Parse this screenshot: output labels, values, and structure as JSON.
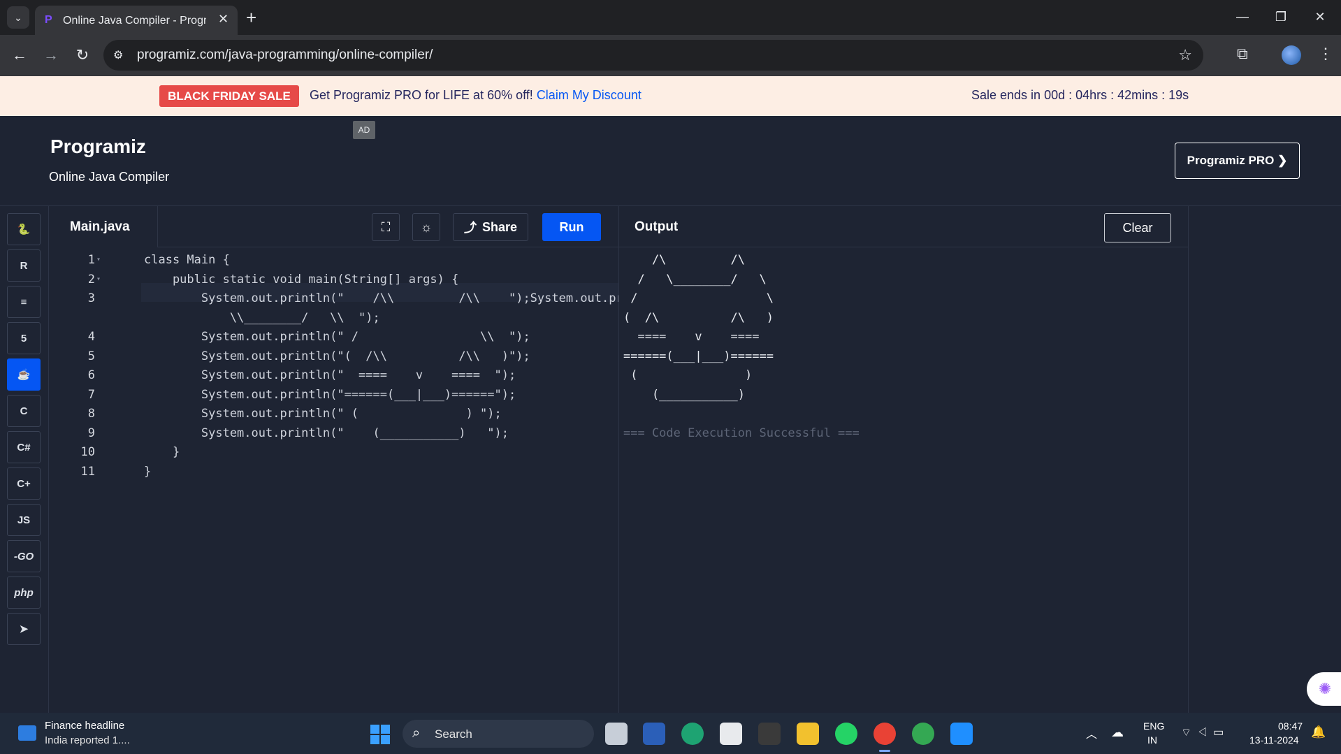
{
  "browser": {
    "tab_title": "Online Java Compiler - Programiz",
    "tab_close": "✕",
    "new_tab": "+",
    "url": "programiz.com/java-programming/online-compiler/",
    "window_controls": {
      "minimize": "—",
      "restore": "❐",
      "close": "✕"
    }
  },
  "promo": {
    "badge": "BLACK FRIDAY SALE",
    "text": "Get Programiz PRO for LIFE at 60% off!",
    "link": "Claim My Discount",
    "sale_ends": "Sale ends in 00d : 04hrs : 42mins : 19s"
  },
  "header": {
    "ad_label": "AD",
    "logo": "Programiz",
    "subtitle": "Online Java Compiler",
    "pro_button": "Programiz PRO ❯"
  },
  "languages": [
    {
      "name": "python",
      "glyph": "🐍"
    },
    {
      "name": "r",
      "glyph": "R"
    },
    {
      "name": "sql",
      "glyph": "≡"
    },
    {
      "name": "html",
      "glyph": "5"
    },
    {
      "name": "java",
      "glyph": "☕",
      "active": true
    },
    {
      "name": "c",
      "glyph": "C"
    },
    {
      "name": "csharp",
      "glyph": "C#"
    },
    {
      "name": "cpp",
      "glyph": "C+"
    },
    {
      "name": "js",
      "glyph": "JS"
    },
    {
      "name": "go",
      "glyph": "-GO"
    },
    {
      "name": "php",
      "glyph": "php"
    },
    {
      "name": "swift",
      "glyph": "➤"
    }
  ],
  "editor": {
    "file_name": "Main.java",
    "share_label": "Share",
    "run_label": "Run",
    "lines": [
      {
        "num": "1",
        "text": "class Main {"
      },
      {
        "num": "2",
        "text": "    public static void main(String[] args) {"
      },
      {
        "num": "3",
        "text": "        System.out.println(\"    /\\\\         /\\\\    \");System.out.printl"
      },
      {
        "num": "",
        "text": "            \\\\________/   \\\\  \");"
      },
      {
        "num": "4",
        "text": "        System.out.println(\" /                 \\\\  \");"
      },
      {
        "num": "5",
        "text": "        System.out.println(\"(  /\\\\          /\\\\   )\");"
      },
      {
        "num": "6",
        "text": "        System.out.println(\"  ====    v    ====  \");"
      },
      {
        "num": "7",
        "text": "        System.out.println(\"======(___|___)======\");"
      },
      {
        "num": "8",
        "text": "        System.out.println(\" (               ) \");"
      },
      {
        "num": "9",
        "text": "        System.out.println(\"    (___________)   \");"
      },
      {
        "num": "10",
        "text": "    }"
      },
      {
        "num": "11",
        "text": "}"
      }
    ]
  },
  "output": {
    "title": "Output",
    "clear_label": "Clear",
    "lines": [
      "    /\\         /\\",
      "  /   \\________/   \\",
      " /                  \\",
      "(  /\\          /\\   )",
      "  ====    v    ====",
      "======(___|___)======",
      " (               )",
      "    (___________)",
      "",
      "=== Code Execution Successful ==="
    ]
  },
  "taskbar": {
    "news_title": "Finance headline",
    "news_sub": "India reported 1....",
    "search_label": "Search",
    "lang_line1": "ENG",
    "lang_line2": "IN",
    "time": "08:47",
    "date": "13-11-2024"
  }
}
